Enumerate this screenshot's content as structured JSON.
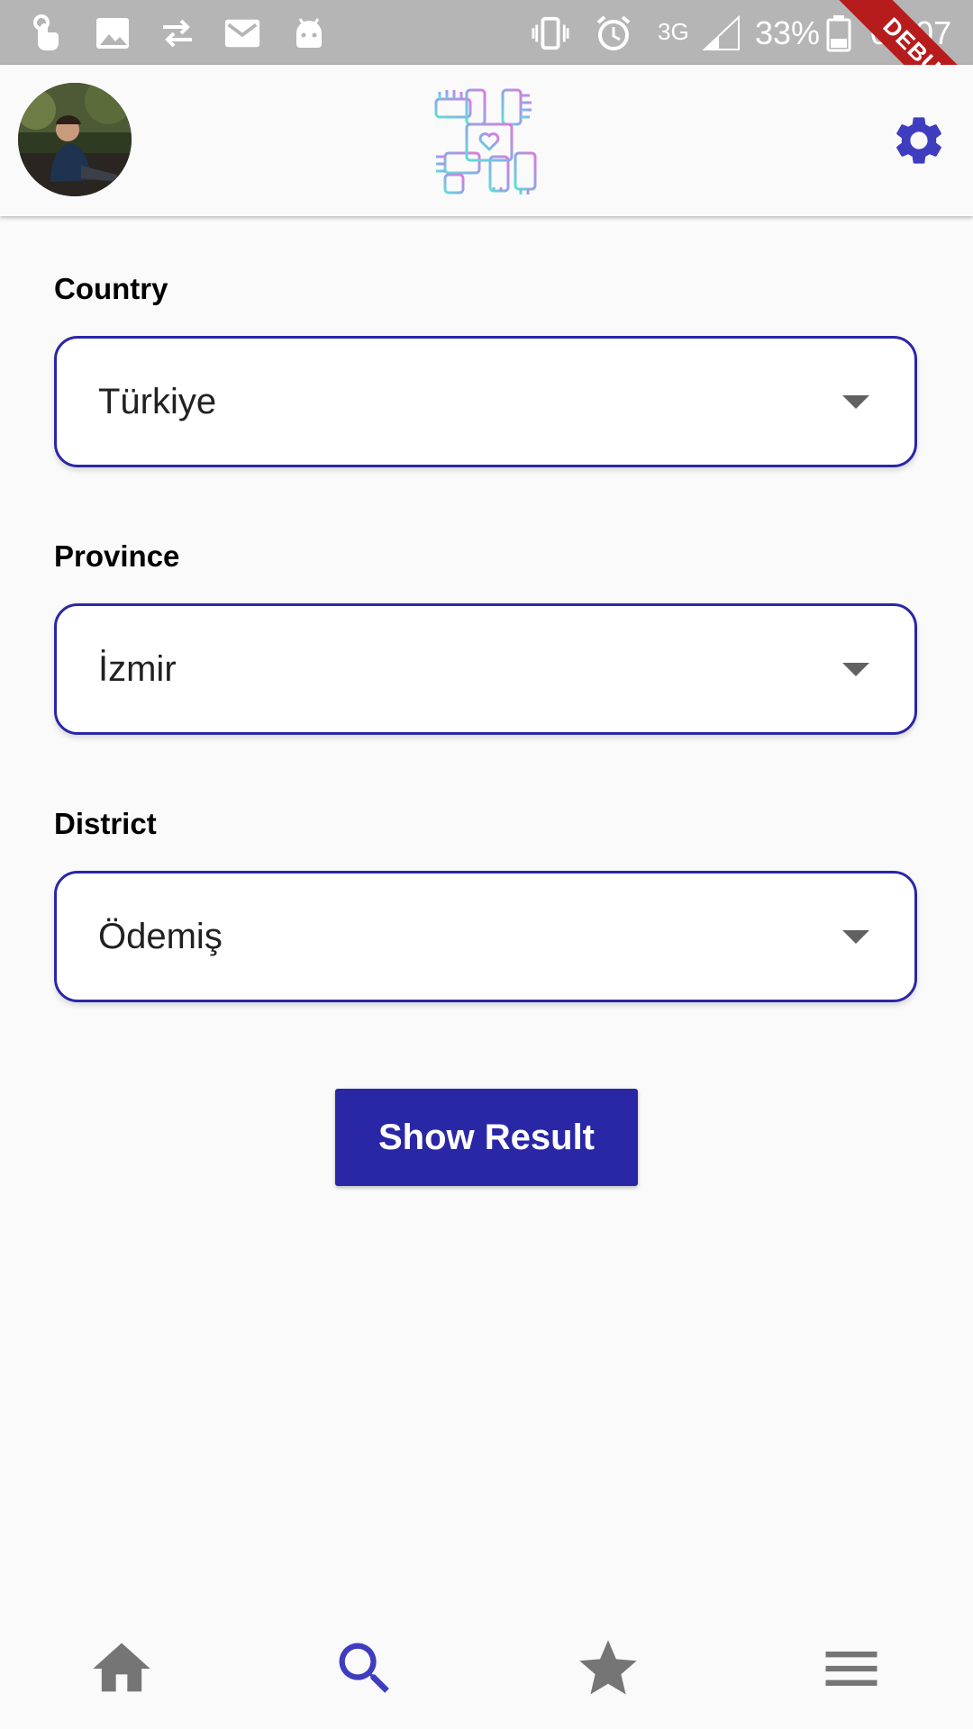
{
  "status_bar": {
    "battery_percent": "33%",
    "time": "03:07",
    "network": "3G",
    "left_icons": [
      "touch-icon",
      "image-icon",
      "sync-arrows-icon",
      "gmail-icon",
      "android-icon"
    ],
    "right_icons": [
      "vibrate-icon",
      "alarm-icon",
      "signal-icon",
      "battery-icon"
    ]
  },
  "debug_banner": "DEBUG",
  "app_bar": {
    "avatar": "profile-avatar",
    "logo": "hands-heart-logo-icon",
    "settings_icon": "gear-icon"
  },
  "form": {
    "country": {
      "label": "Country",
      "value": "Türkiye"
    },
    "province": {
      "label": "Province",
      "value": "İzmir"
    },
    "district": {
      "label": "District",
      "value": "Ödemiş"
    },
    "submit_label": "Show Result"
  },
  "bottom_nav": {
    "items": [
      {
        "icon": "home-icon",
        "active": false
      },
      {
        "icon": "search-icon",
        "active": true
      },
      {
        "icon": "star-icon",
        "active": false
      },
      {
        "icon": "menu-icon",
        "active": false
      }
    ]
  },
  "colors": {
    "accent": "#2a27a6",
    "icon_active": "#3f3dbf",
    "icon_inactive": "#757575",
    "status_bar": "#b5b5b5",
    "debug": "#b71c1c"
  }
}
